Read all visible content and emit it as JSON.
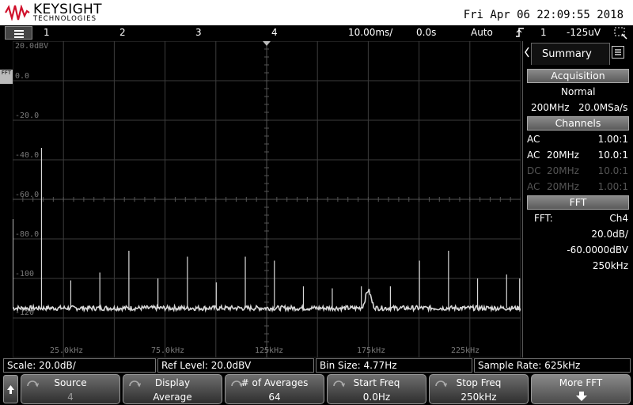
{
  "header": {
    "brand": "KEYSIGHT",
    "brand_sub": "TECHNOLOGIES",
    "datetime": "Fri Apr 06 22:09:55 2018"
  },
  "status_bar": {
    "channels": [
      "1",
      "2",
      "3",
      "4"
    ],
    "timebase": "10.00ms/",
    "delay": "0.0s",
    "trigger_mode": "Auto",
    "trigger_source": "1",
    "trigger_level": "-125uV"
  },
  "plot": {
    "y_labels": [
      "20.0dBV",
      "0.0",
      "-20.0",
      "-40.0",
      "-60.0",
      "-80.0",
      "-100",
      "-120"
    ],
    "x_labels": [
      "25.0kHz",
      "75.0kHz",
      "125kHz",
      "175kHz",
      "225kHz"
    ],
    "fft_marker": "FFT",
    "trace_color": "#d8d8d8",
    "grid_color": "#3c3c3c"
  },
  "chart_data": {
    "type": "line",
    "title": "",
    "xlabel": "",
    "ylabel": "",
    "xlim": [
      0,
      250
    ],
    "ylim": [
      -140,
      20
    ],
    "x_unit": "kHz",
    "y_unit": "dBV",
    "noise_floor": -115,
    "spikes": [
      {
        "x": 0.1,
        "y": -70
      },
      {
        "x": 14.2,
        "y": -34
      },
      {
        "x": 28.6,
        "y": -101
      },
      {
        "x": 42.9,
        "y": -97
      },
      {
        "x": 57.2,
        "y": -86
      },
      {
        "x": 71.5,
        "y": -100
      },
      {
        "x": 86.0,
        "y": -89
      },
      {
        "x": 100.2,
        "y": -102
      },
      {
        "x": 114.5,
        "y": -89
      },
      {
        "x": 128.8,
        "y": -91
      },
      {
        "x": 143.1,
        "y": -104
      },
      {
        "x": 157.3,
        "y": -105
      },
      {
        "x": 171.6,
        "y": -104
      },
      {
        "x": 185.9,
        "y": -104
      },
      {
        "x": 200.2,
        "y": -91
      },
      {
        "x": 214.5,
        "y": -86
      },
      {
        "x": 228.8,
        "y": -100
      },
      {
        "x": 243.1,
        "y": -98
      },
      {
        "x": 249.5,
        "y": -100
      }
    ],
    "bump": {
      "x": 175,
      "y": -106
    }
  },
  "summary": {
    "tab_label": "Summary",
    "acquisition_title": "Acquisition",
    "acq_mode": "Normal",
    "bandwidth": "200MHz",
    "sample_rate": "20.0MSa/s",
    "channels_title": "Channels",
    "channels": [
      {
        "coupling": "AC",
        "bw": "",
        "probe": "1.00:1",
        "dim": false
      },
      {
        "coupling": "AC",
        "bw": "20MHz",
        "probe": "10.0:1",
        "dim": false
      },
      {
        "coupling": "DC",
        "bw": "20MHz",
        "probe": "10.0:1",
        "dim": true
      },
      {
        "coupling": "AC",
        "bw": "20MHz",
        "probe": "1.00:1",
        "dim": true
      }
    ],
    "fft_title": "FFT",
    "fft_label": "FFT:",
    "fft_source": "Ch4",
    "fft_scale": "20.0dB/",
    "fft_offset": "-60.0000dBV",
    "fft_span": "250kHz"
  },
  "info_row": {
    "scale": "Scale: 20.0dB/",
    "ref_level": "Ref Level: 20.0dBV",
    "bin_size": "Bin Size: 4.77Hz",
    "sample_rate": "Sample Rate: 625kHz"
  },
  "softkeys": {
    "source_label": "Source",
    "source_value": "4",
    "display_label": "Display",
    "display_value": "Average",
    "averages_label": "# of Averages",
    "averages_value": "64",
    "start_label": "Start Freq",
    "start_value": "0.0Hz",
    "stop_label": "Stop Freq",
    "stop_value": "250kHz",
    "more_label": "More FFT"
  }
}
